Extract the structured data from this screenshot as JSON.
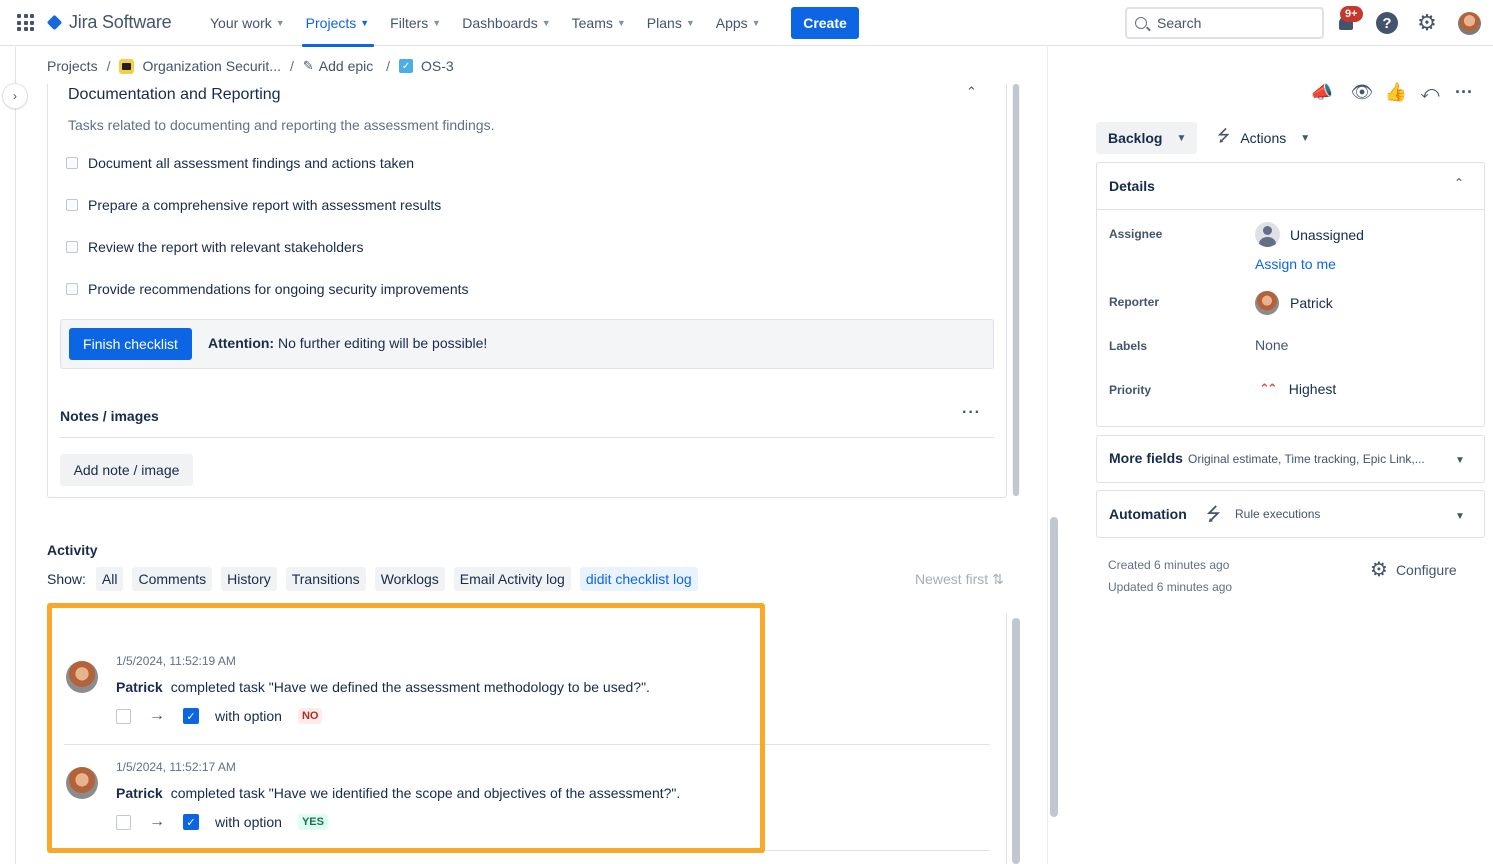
{
  "app": {
    "name": "Jira Software"
  },
  "nav": {
    "items": [
      {
        "label": "Your work",
        "active": false
      },
      {
        "label": "Projects",
        "active": true
      },
      {
        "label": "Filters",
        "active": false
      },
      {
        "label": "Dashboards",
        "active": false
      },
      {
        "label": "Teams",
        "active": false
      },
      {
        "label": "Plans",
        "active": false
      },
      {
        "label": "Apps",
        "active": false
      }
    ],
    "create_label": "Create",
    "search_placeholder": "Search",
    "notifications_badge": "9+",
    "help_icon": "?"
  },
  "breadcrumb": {
    "projects": "Projects",
    "project": "Organization Securit...",
    "epic": "Add epic",
    "issue": "OS-3"
  },
  "checklist": {
    "section_title": "Documentation and Reporting",
    "section_desc": "Tasks related to documenting and reporting the assessment findings.",
    "items": [
      "Document all assessment findings and actions taken",
      "Prepare a comprehensive report with assessment results",
      "Review the report with relevant stakeholders",
      "Provide recommendations for ongoing security improvements"
    ],
    "finish_label": "Finish checklist",
    "attention_label": "Attention:",
    "attention_text": "No further editing will be possible!",
    "notes_title": "Notes / images",
    "add_note_label": "Add note / image"
  },
  "activity": {
    "title": "Activity",
    "show_label": "Show:",
    "filters": [
      {
        "label": "All",
        "active": false
      },
      {
        "label": "Comments",
        "active": false
      },
      {
        "label": "History",
        "active": false
      },
      {
        "label": "Transitions",
        "active": false
      },
      {
        "label": "Worklogs",
        "active": false
      },
      {
        "label": "Email Activity log",
        "active": false
      },
      {
        "label": "didit checklist log",
        "active": true
      }
    ],
    "sort_label": "Newest first",
    "entries": [
      {
        "time": "1/5/2024, 11:52:19 AM",
        "user": "Patrick",
        "text": "completed task \"Have we defined the assessment methodology to be used?\".",
        "with_option": "with option",
        "option": "NO"
      },
      {
        "time": "1/5/2024, 11:52:17 AM",
        "user": "Patrick",
        "text": "completed task \"Have we identified the scope and objectives of the assessment?\".",
        "with_option": "with option",
        "option": "YES"
      }
    ]
  },
  "sidebar": {
    "status_label": "Backlog",
    "actions_label": "Actions",
    "details": {
      "title": "Details",
      "assignee_label": "Assignee",
      "assignee_value": "Unassigned",
      "assign_to_me": "Assign to me",
      "reporter_label": "Reporter",
      "reporter_value": "Patrick",
      "labels_label": "Labels",
      "labels_value": "None",
      "priority_label": "Priority",
      "priority_value": "Highest"
    },
    "more_fields": {
      "title": "More fields",
      "subtitle": "Original estimate, Time tracking, Epic Link,..."
    },
    "automation": {
      "title": "Automation",
      "subtitle": "Rule executions"
    },
    "created": "Created 6 minutes ago",
    "updated": "Updated 6 minutes ago",
    "configure_label": "Configure"
  },
  "colors": {
    "brand": "#0c66e4",
    "highlight_border": "#f8a92a",
    "no_lozenge": "#ae2e24",
    "yes_lozenge": "#216e4e"
  }
}
